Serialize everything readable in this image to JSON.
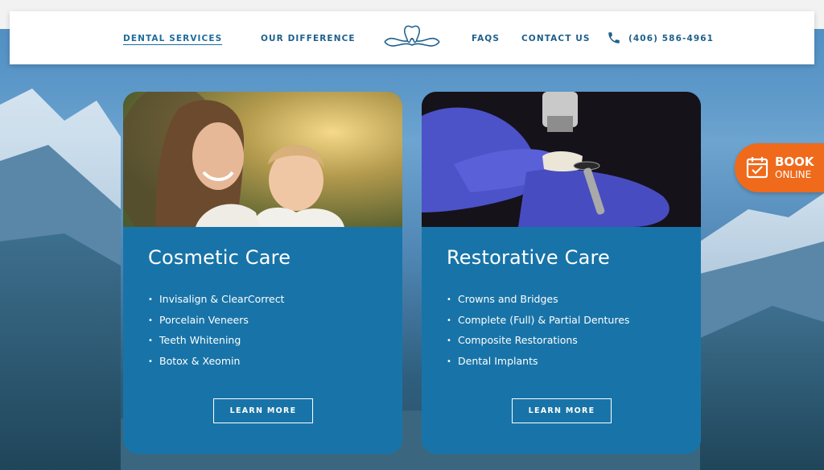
{
  "nav": {
    "dental_services": "DENTAL SERVICES",
    "our_difference": "OUR DIFFERENCE",
    "faqs": "FAQS",
    "contact_us": "CONTACT US",
    "phone": "(406) 586-4961",
    "logo_icon": "tooth-logo-icon",
    "phone_icon": "phone-icon"
  },
  "cards": [
    {
      "title": "Cosmetic Care",
      "image": "mother-and-daughter-photo",
      "items": [
        "Invisalign & ClearCorrect",
        "Porcelain Veneers",
        "Teeth Whitening",
        "Botox & Xeomin"
      ],
      "button": "LEARN MORE"
    },
    {
      "title": "Restorative Care",
      "image": "dental-crown-polishing-photo",
      "items": [
        "Crowns and Bridges",
        "Complete (Full) & Partial Dentures",
        "Composite Restorations",
        "Dental Implants"
      ],
      "button": "LEARN MORE"
    }
  ],
  "book": {
    "line1": "BOOK",
    "line2": "ONLINE",
    "icon": "calendar-check-icon"
  },
  "colors": {
    "brand_blue": "#1874a8",
    "nav_text": "#1e5f8c",
    "book_orange": "#ef6a1b"
  }
}
